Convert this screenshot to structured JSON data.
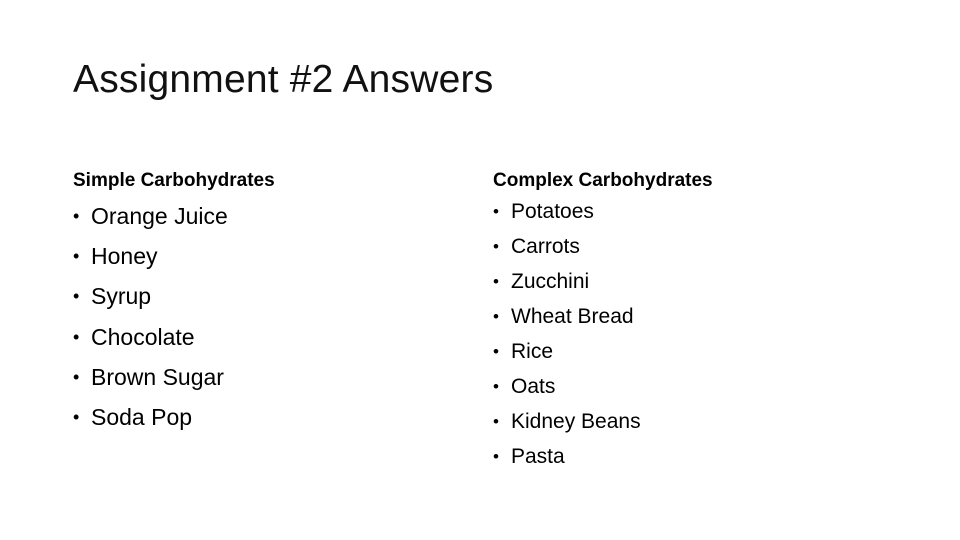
{
  "slide": {
    "title": "Assignment #2 Answers",
    "columns": [
      {
        "heading": "Simple Carbohydrates",
        "bullet": "•",
        "items": [
          "Orange Juice",
          "Honey",
          "Syrup",
          "Chocolate",
          "Brown Sugar",
          "Soda Pop"
        ]
      },
      {
        "heading": "Complex Carbohydrates",
        "bullet": "•",
        "items": [
          "Potatoes",
          "Carrots",
          "Zucchini",
          "Wheat Bread",
          "Rice",
          "Oats",
          "Kidney Beans",
          "Pasta"
        ]
      }
    ]
  }
}
